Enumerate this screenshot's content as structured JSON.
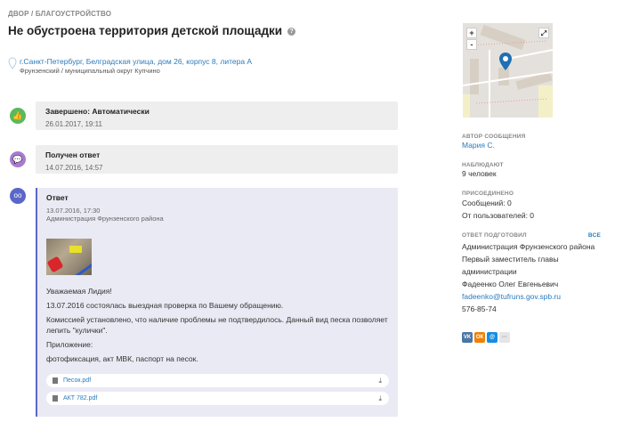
{
  "breadcrumb": "ДВОР / БЛАГОУСТРОЙСТВО",
  "title": "Не обустроена территория детской площадки",
  "help": "?",
  "address": "г.Санкт-Петербург, Белградская улица, дом 26, корпус 8, литера А",
  "district": "Фрунзенский / муниципальный округ Купчино",
  "timeline": [
    {
      "title": "Завершено: Автоматически",
      "date": "26.01.2017, 19:11",
      "icon": "thumbs-up-icon",
      "color": "#5cb85c"
    },
    {
      "title": "Получен ответ",
      "date": "14.07.2016, 14:57",
      "icon": "chat-icon",
      "color": "#a97bcf"
    }
  ],
  "answer": {
    "title": "Ответ",
    "date": "13.07.2016, 17:30",
    "author": "Администрация Фрунзенского района",
    "icon_color": "#5a67c9",
    "paragraphs": [
      "Уважаемая Лидия!",
      "13.07.2016 состоялась выездная проверка по Вашему обращению.",
      "Комиссией установлено, что наличие проблемы не подтвердилось. Данный вид песка позволяет лепить \"кулички\".",
      "Приложение:",
      "фотофиксация, акт МВК, паспорт на песок."
    ],
    "files": [
      "Песок.pdf",
      "АКТ 782.pdf"
    ]
  },
  "map": {
    "zoom_in": "+",
    "zoom_out": "-"
  },
  "sidebar": {
    "author_label": "АВТОР СООБЩЕНИЯ",
    "author": "Мария С.",
    "watchers_label": "НАБЛЮДАЮТ",
    "watchers": "9 человек",
    "joined_label": "ПРИСОЕДИНЕНО",
    "joined_messages": "Сообщений: 0",
    "joined_users": "От пользователей: 0",
    "prepared_label": "ОТВЕТ ПОДГОТОВИЛ",
    "all": "ВСЕ",
    "org": "Администрация Фрунзенского района",
    "position": "Первый заместитель главы администрации",
    "person": "Фадеенко Олег Евгеньевич",
    "email": "fadeenko@tufruns.gov.spb.ru",
    "phone": "576-85-74",
    "social": [
      {
        "name": "vk",
        "label": "VK",
        "color": "#4a76a8"
      },
      {
        "name": "ok",
        "label": "ОК",
        "color": "#ee8208"
      },
      {
        "name": "mail",
        "label": "@",
        "color": "#168de2"
      },
      {
        "name": "more",
        "label": "···",
        "color": "#e5e5e5"
      }
    ]
  }
}
